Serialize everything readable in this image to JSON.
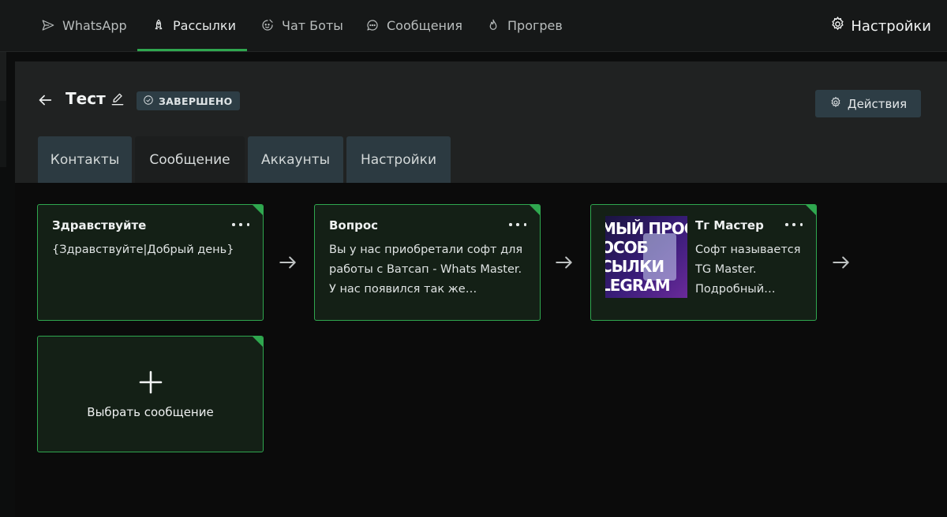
{
  "nav": {
    "items": [
      {
        "label": "WhatsApp",
        "icon": "send-icon"
      },
      {
        "label": "Рассылки",
        "icon": "rocket-icon"
      },
      {
        "label": "Чат Боты",
        "icon": "bot-icon"
      },
      {
        "label": "Сообщения",
        "icon": "chat-icon"
      },
      {
        "label": "Прогрев",
        "icon": "flame-icon"
      }
    ],
    "active_index": 1,
    "settings_label": "Настройки"
  },
  "campaign": {
    "title": "Тест",
    "status": "ЗАВЕРШЕНО",
    "actions_label": "Действия"
  },
  "tabs": [
    {
      "label": "Контакты"
    },
    {
      "label": "Сообщение"
    },
    {
      "label": "Аккаунты"
    },
    {
      "label": "Настройки"
    }
  ],
  "active_tab_index": 1,
  "messages": [
    {
      "title": "Здравствуйте",
      "text": "{Здравствуйте|Добрый день}"
    },
    {
      "title": "Вопрос",
      "text": "Вы у нас приобретали софт для работы с Ватсап - Whats Master. У нас появился так же…"
    },
    {
      "title": "Тг Мастер",
      "text": "Софт называется TG Master. Подробный…",
      "thumb_lines": [
        "МЫЙ ПРОСТ",
        "ОСОБ",
        "СЫЛКИ",
        "LEGRAM"
      ]
    }
  ],
  "add_message_label": "Выбрать сообщение",
  "colors": {
    "accent": "#2fa74f",
    "badge_bg": "#2d3d45",
    "card_bg": "#142016"
  }
}
